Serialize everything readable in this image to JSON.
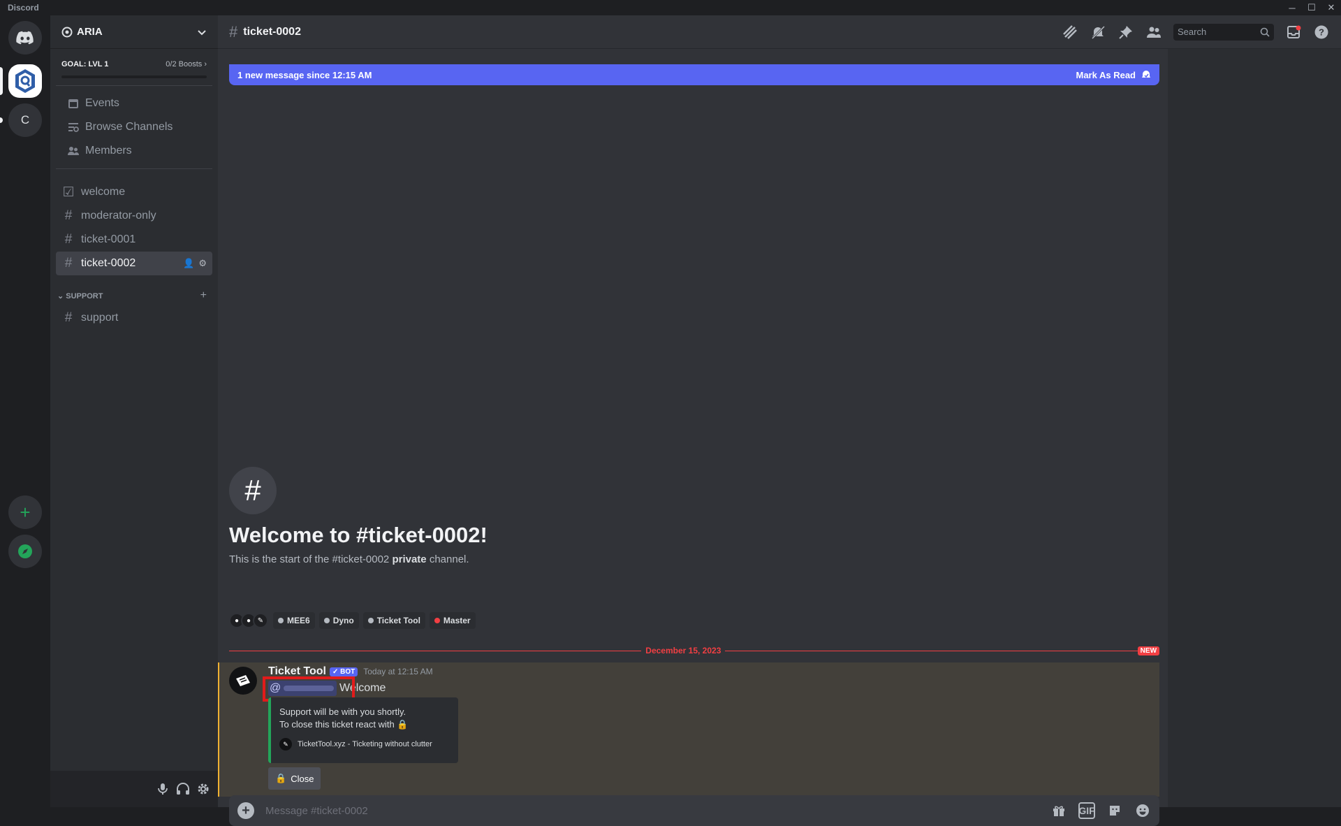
{
  "app": {
    "title": "Discord"
  },
  "window_controls": {
    "minimize": "─",
    "maximize": "☐",
    "close": "✕"
  },
  "servers": [
    {
      "name": "Direct Messages",
      "icon": "discord-logo-icon"
    },
    {
      "name": "ARIA",
      "icon": "aria-server-icon"
    },
    {
      "name": "C",
      "label": "C"
    },
    {
      "name": "Add a Server",
      "icon": "plus-icon",
      "label": "+"
    },
    {
      "name": "Explore Discoverable Servers",
      "icon": "compass-icon"
    }
  ],
  "server": {
    "name": "ARIA",
    "boost_goal": "GOAL: LVL 1",
    "boost_count": "0/2 Boosts",
    "boost_progress": 0
  },
  "nav": [
    {
      "label": "Events",
      "icon": "calendar-icon"
    },
    {
      "label": "Browse Channels",
      "icon": "browse-channels-icon"
    },
    {
      "label": "Members",
      "icon": "members-icon"
    }
  ],
  "channels": [
    {
      "label": "welcome",
      "icon": "rules-icon"
    },
    {
      "label": "moderator-only",
      "icon": "hash-lock-icon"
    },
    {
      "label": "ticket-0001",
      "icon": "hash-lock-icon"
    },
    {
      "label": "ticket-0002",
      "icon": "hash-lock-icon",
      "active": true
    }
  ],
  "category": {
    "label": "SUPPORT",
    "add": "+"
  },
  "support_channels": [
    {
      "label": "support",
      "icon": "hash-icon"
    }
  ],
  "header": {
    "channel": "ticket-0002",
    "search_placeholder": "Search"
  },
  "new_messages": {
    "text": "1 new message since 12:15 AM",
    "action": "Mark As Read"
  },
  "welcome": {
    "title": "Welcome to #ticket-0002!",
    "subtitle_pre": "This is the start of the #ticket-0002 ",
    "subtitle_bold": "private",
    "subtitle_post": " channel."
  },
  "role_tags": [
    {
      "label": "MEE6",
      "color": "#b5bac1"
    },
    {
      "label": "Dyno",
      "color": "#b5bac1"
    },
    {
      "label": "Ticket Tool",
      "color": "#b5bac1"
    },
    {
      "label": "Master",
      "color": "#f23f43"
    }
  ],
  "divider": {
    "date": "December 15, 2023",
    "badge": "NEW"
  },
  "message": {
    "author": "Ticket Tool",
    "badge": "✓ BOT",
    "time": "Today at 12:15 AM",
    "mention_prefix": "@",
    "text": "Welcome",
    "embed_line1": "Support will be with you shortly.",
    "embed_line2": "To close this ticket react with 🔒",
    "embed_footer": "TicketTool.xyz - Ticketing without clutter",
    "button_label": "Close",
    "button_icon": "🔒"
  },
  "composer": {
    "placeholder": "Message #ticket-0002"
  },
  "colors": {
    "accent": "#5865f2",
    "danger": "#f23f43",
    "embed_border": "#23a55a",
    "highlight": "#f0b232"
  }
}
